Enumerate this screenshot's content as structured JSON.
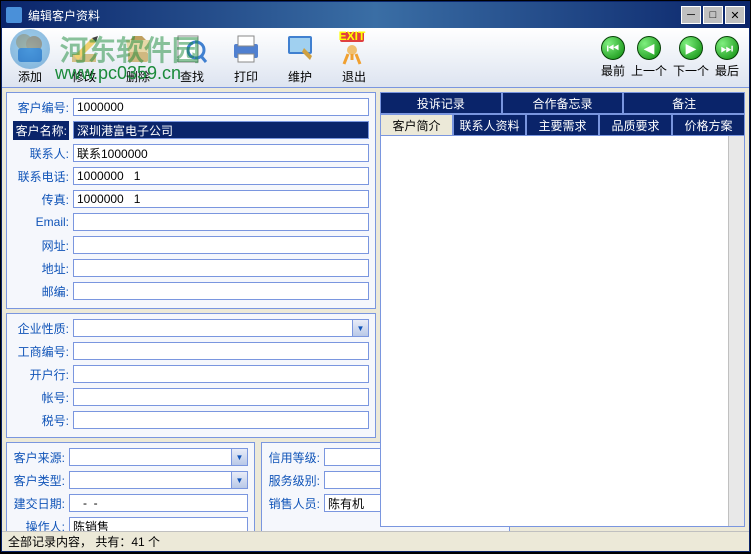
{
  "window": {
    "title": "编辑客户资料"
  },
  "watermark": {
    "text": "河东软件园",
    "url": "www.pc0359.cn"
  },
  "toolbar": {
    "add": "添加",
    "edit": "修改",
    "delete": "删除",
    "find": "查找",
    "print": "打印",
    "maintain": "维护",
    "exit": "退出"
  },
  "nav": {
    "first": "最前",
    "prev": "上一个",
    "next": "下一个",
    "last": "最后"
  },
  "fields": {
    "customer_no_label": "客户编号:",
    "customer_no": "1000000",
    "customer_name_label": "客户名称:",
    "customer_name": "深圳港富电子公司",
    "contact_label": "联系人:",
    "contact": "联系1000000",
    "phone_label": "联系电话:",
    "phone": "1000000   1",
    "fax_label": "传真:",
    "fax": "1000000   1",
    "email_label": "Email:",
    "email": "",
    "website_label": "网址:",
    "website": "",
    "address_label": "地址:",
    "address": "",
    "postcode_label": "邮编:",
    "postcode": ""
  },
  "company": {
    "nature_label": "企业性质:",
    "nature": "",
    "reg_no_label": "工商编号:",
    "reg_no": "",
    "bank_label": "开户行:",
    "bank": "",
    "account_label": "帐号:",
    "account": "",
    "tax_label": "税号:",
    "tax": ""
  },
  "meta_left": {
    "source_label": "客户来源:",
    "source": "",
    "type_label": "客户类型:",
    "type": "",
    "date_label": "建交日期:",
    "date": "   -  -",
    "operator_label": "操作人:",
    "operator": "陈销售"
  },
  "meta_right": {
    "credit_label": "信用等级:",
    "credit": "",
    "service_label": "服务级别:",
    "service": "",
    "sales_label": "销售人员:",
    "sales": "陈有机"
  },
  "tabs_top": {
    "complaint": "投诉记录",
    "memo": "合作备忘录",
    "remark": "备注"
  },
  "tabs_bottom": {
    "intro": "客户简介",
    "contact_info": "联系人资料",
    "demand": "主要需求",
    "quality": "品质要求",
    "price": "价格方案"
  },
  "status": {
    "text": "全部记录内容，  共有：41   个"
  }
}
